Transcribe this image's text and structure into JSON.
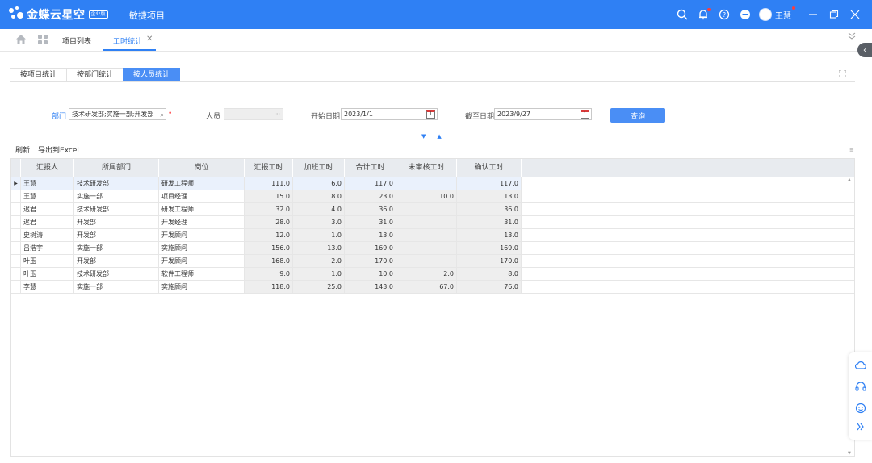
{
  "app": {
    "logo_text": "金蝶云星空",
    "logo_badge": "企业版",
    "title": "敏捷项目",
    "user_name": "王慧"
  },
  "tabs": {
    "items": [
      {
        "label": "项目列表"
      },
      {
        "label": "工时统计"
      }
    ]
  },
  "subtabs": [
    {
      "label": "按项目统计"
    },
    {
      "label": "按部门统计"
    },
    {
      "label": "按人员统计"
    }
  ],
  "filters": {
    "dept_label": "部门",
    "dept_value": "技术研发部;实施一部;开发部",
    "person_label": "人员",
    "start_label": "开始日期",
    "start_value": "2023/1/1",
    "end_label": "截至日期",
    "end_value": "2023/9/27",
    "query_label": "查询"
  },
  "toolbar": {
    "refresh_label": "刷新",
    "export_label": "导出到Excel"
  },
  "grid": {
    "columns": [
      "汇报人",
      "所属部门",
      "岗位",
      "汇报工时",
      "加班工时",
      "合计工时",
      "未审核工时",
      "确认工时"
    ],
    "rows": [
      [
        "王慧",
        "技术研发部",
        "研发工程师",
        "111.0",
        "6.0",
        "117.0",
        "",
        "117.0"
      ],
      [
        "王慧",
        "实施一部",
        "项目经理",
        "15.0",
        "8.0",
        "23.0",
        "10.0",
        "13.0"
      ],
      [
        "迟君",
        "技术研发部",
        "研发工程师",
        "32.0",
        "4.0",
        "36.0",
        "",
        "36.0"
      ],
      [
        "迟君",
        "开发部",
        "开发经理",
        "28.0",
        "3.0",
        "31.0",
        "",
        "31.0"
      ],
      [
        "史树涛",
        "开发部",
        "开发顾问",
        "12.0",
        "1.0",
        "13.0",
        "",
        "13.0"
      ],
      [
        "吕浩宇",
        "实施一部",
        "实施顾问",
        "156.0",
        "13.0",
        "169.0",
        "",
        "169.0"
      ],
      [
        "叶玉",
        "开发部",
        "开发顾问",
        "168.0",
        "2.0",
        "170.0",
        "",
        "170.0"
      ],
      [
        "叶玉",
        "技术研发部",
        "软件工程师",
        "9.0",
        "1.0",
        "10.0",
        "2.0",
        "8.0"
      ],
      [
        "李慧",
        "实施一部",
        "实施顾问",
        "118.0",
        "25.0",
        "143.0",
        "67.0",
        "76.0"
      ]
    ]
  },
  "colors": {
    "brand": "#2f80f4",
    "accent_tab": "#4a8ef5",
    "required": "#ff4d4f"
  }
}
